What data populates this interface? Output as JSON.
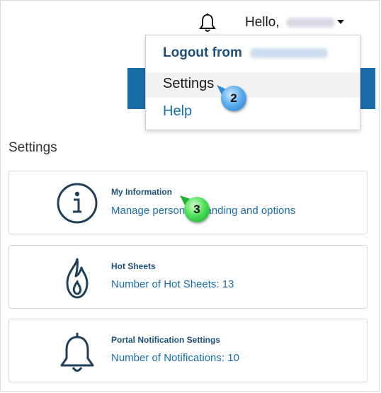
{
  "header": {
    "greeting": "Hello,",
    "user_menu": {
      "logout_label": "Logout from",
      "settings_label": "Settings",
      "help_label": "Help"
    }
  },
  "callouts": {
    "step2": "2",
    "step3": "3"
  },
  "settings_page": {
    "title": "Settings",
    "cards": [
      {
        "title": "My Information",
        "subtitle": "Manage personal branding and options",
        "icon": "info-icon"
      },
      {
        "title": "Hot Sheets",
        "subtitle": "Number of Hot Sheets: 13",
        "icon": "flame-icon"
      },
      {
        "title": "Portal Notification Settings",
        "subtitle": "Number of Notifications: 10",
        "icon": "bell-icon"
      }
    ]
  },
  "colors": {
    "accent": "#1a6ca8",
    "header_bar": "#1a6ca8",
    "card_title": "#1f4f7a",
    "icon_stroke": "#1f3e5a"
  }
}
